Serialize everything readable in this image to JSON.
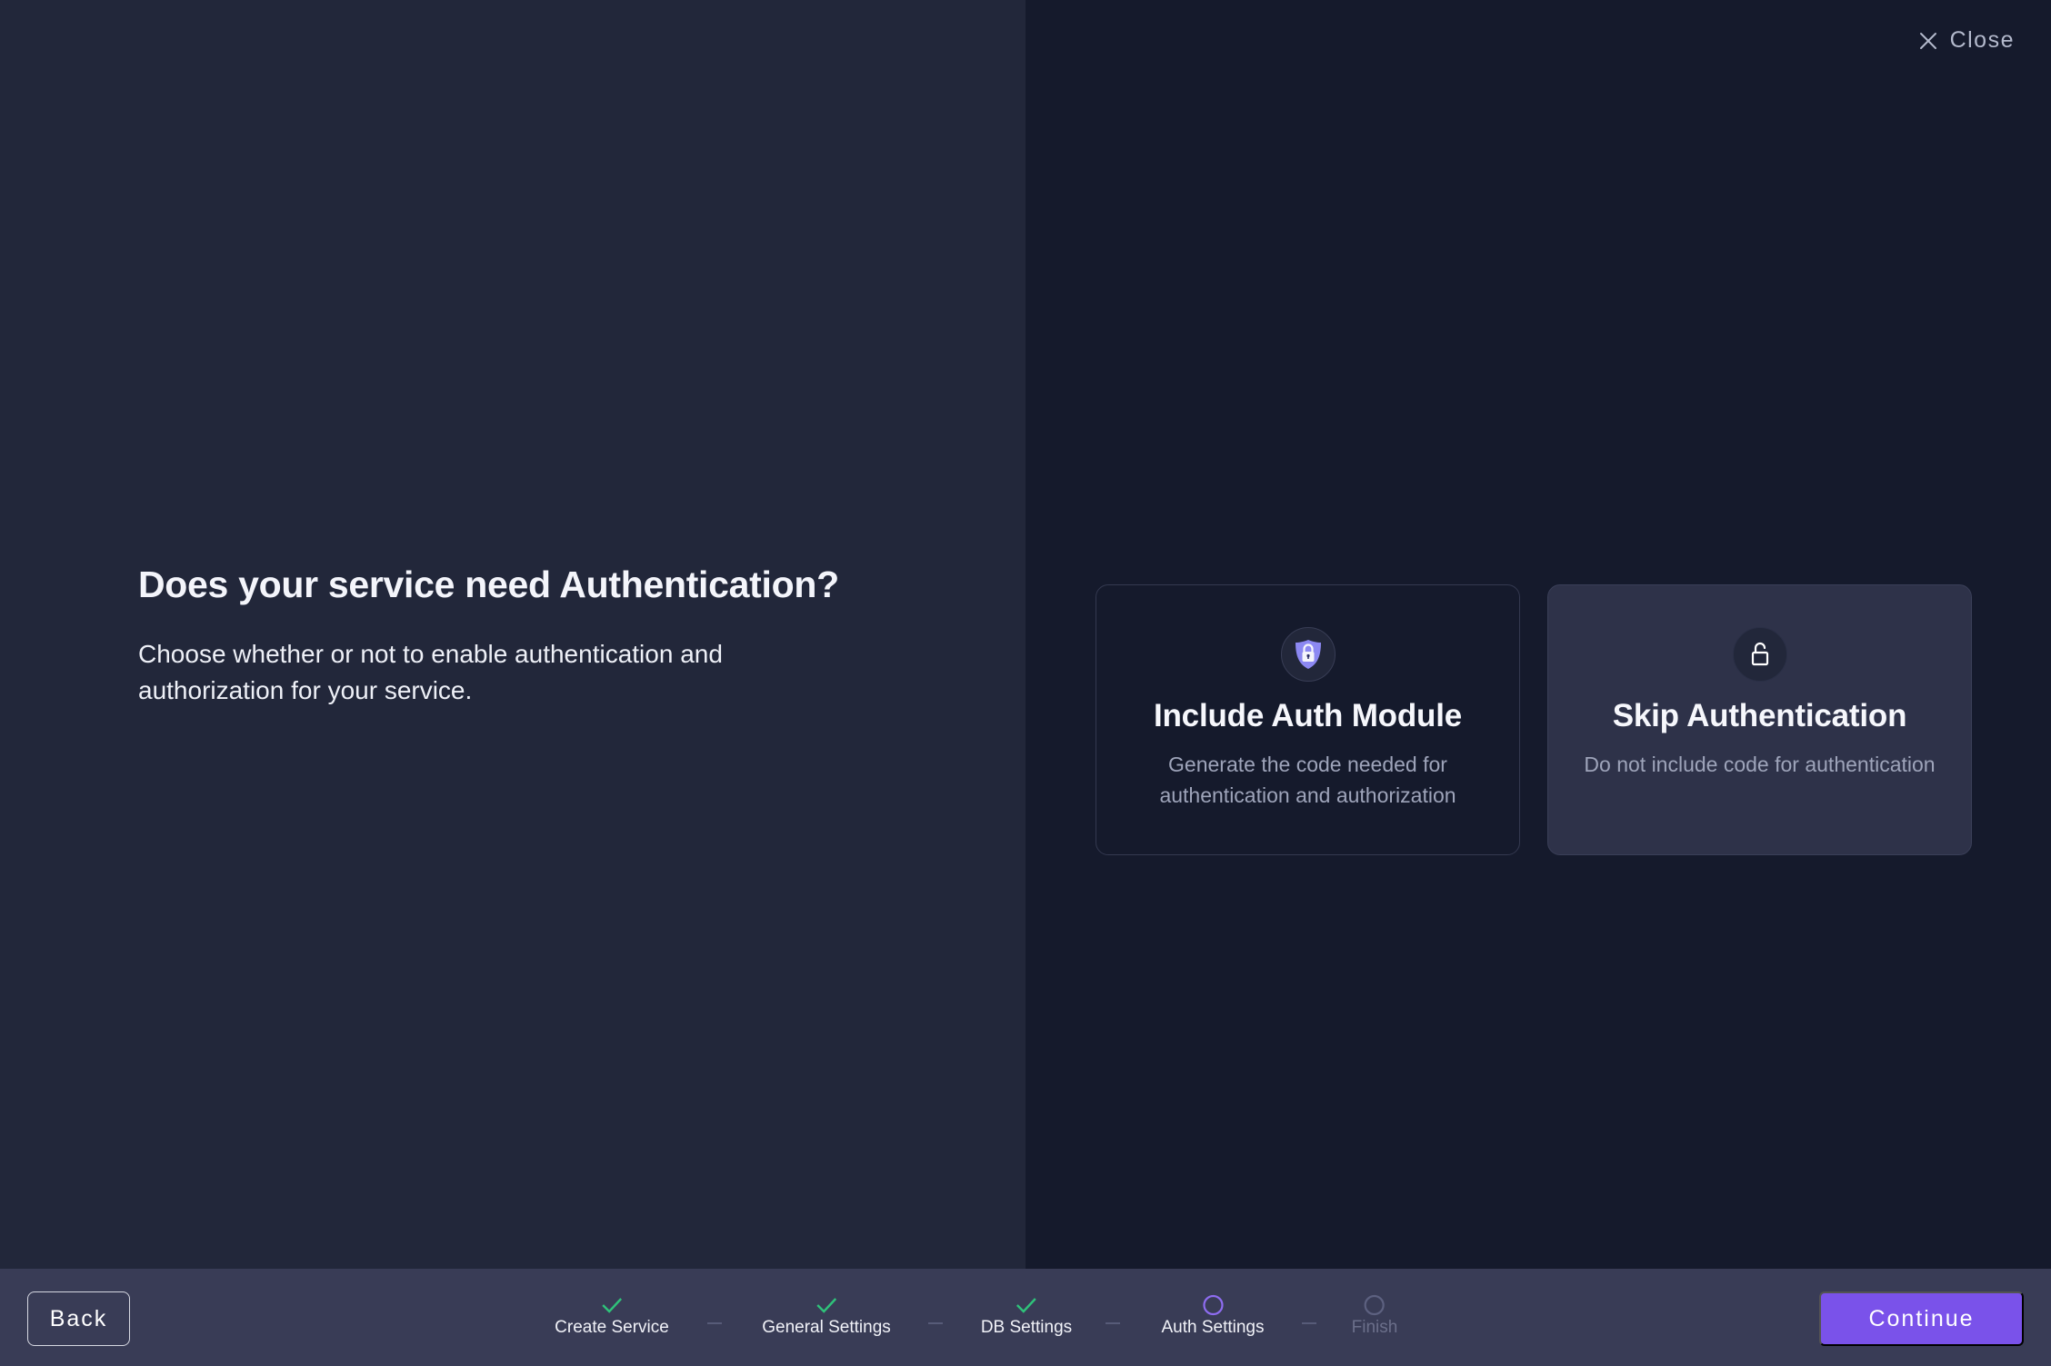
{
  "header": {
    "close_label": "Close",
    "close_icon": "x-icon"
  },
  "intro": {
    "title": "Does your service need Authentication?",
    "description": "Choose whether or not to enable authentication and authorization for your service."
  },
  "options": [
    {
      "title": "Include Auth Module",
      "description": "Generate the code needed for authentication and authorization",
      "icon": "shield-lock-icon",
      "icon_color": "#8c88f2",
      "selected": false
    },
    {
      "title": "Skip Authentication",
      "description": "Do not include code for authentication",
      "icon": "unlock-icon",
      "selected": true
    }
  ],
  "footer": {
    "back_label": "Back",
    "continue_label": "Continue",
    "accent_color": "#7a52ea",
    "steps": [
      {
        "label": "Create Service",
        "status": "completed"
      },
      {
        "label": "General Settings",
        "status": "completed"
      },
      {
        "label": "DB Settings",
        "status": "completed"
      },
      {
        "label": "Auth Settings",
        "status": "current"
      },
      {
        "label": "Finish",
        "status": "pending"
      }
    ],
    "status_colors": {
      "completed": "#2fc27a",
      "current": "#8e6cf0",
      "pending": "#5d6180"
    }
  }
}
